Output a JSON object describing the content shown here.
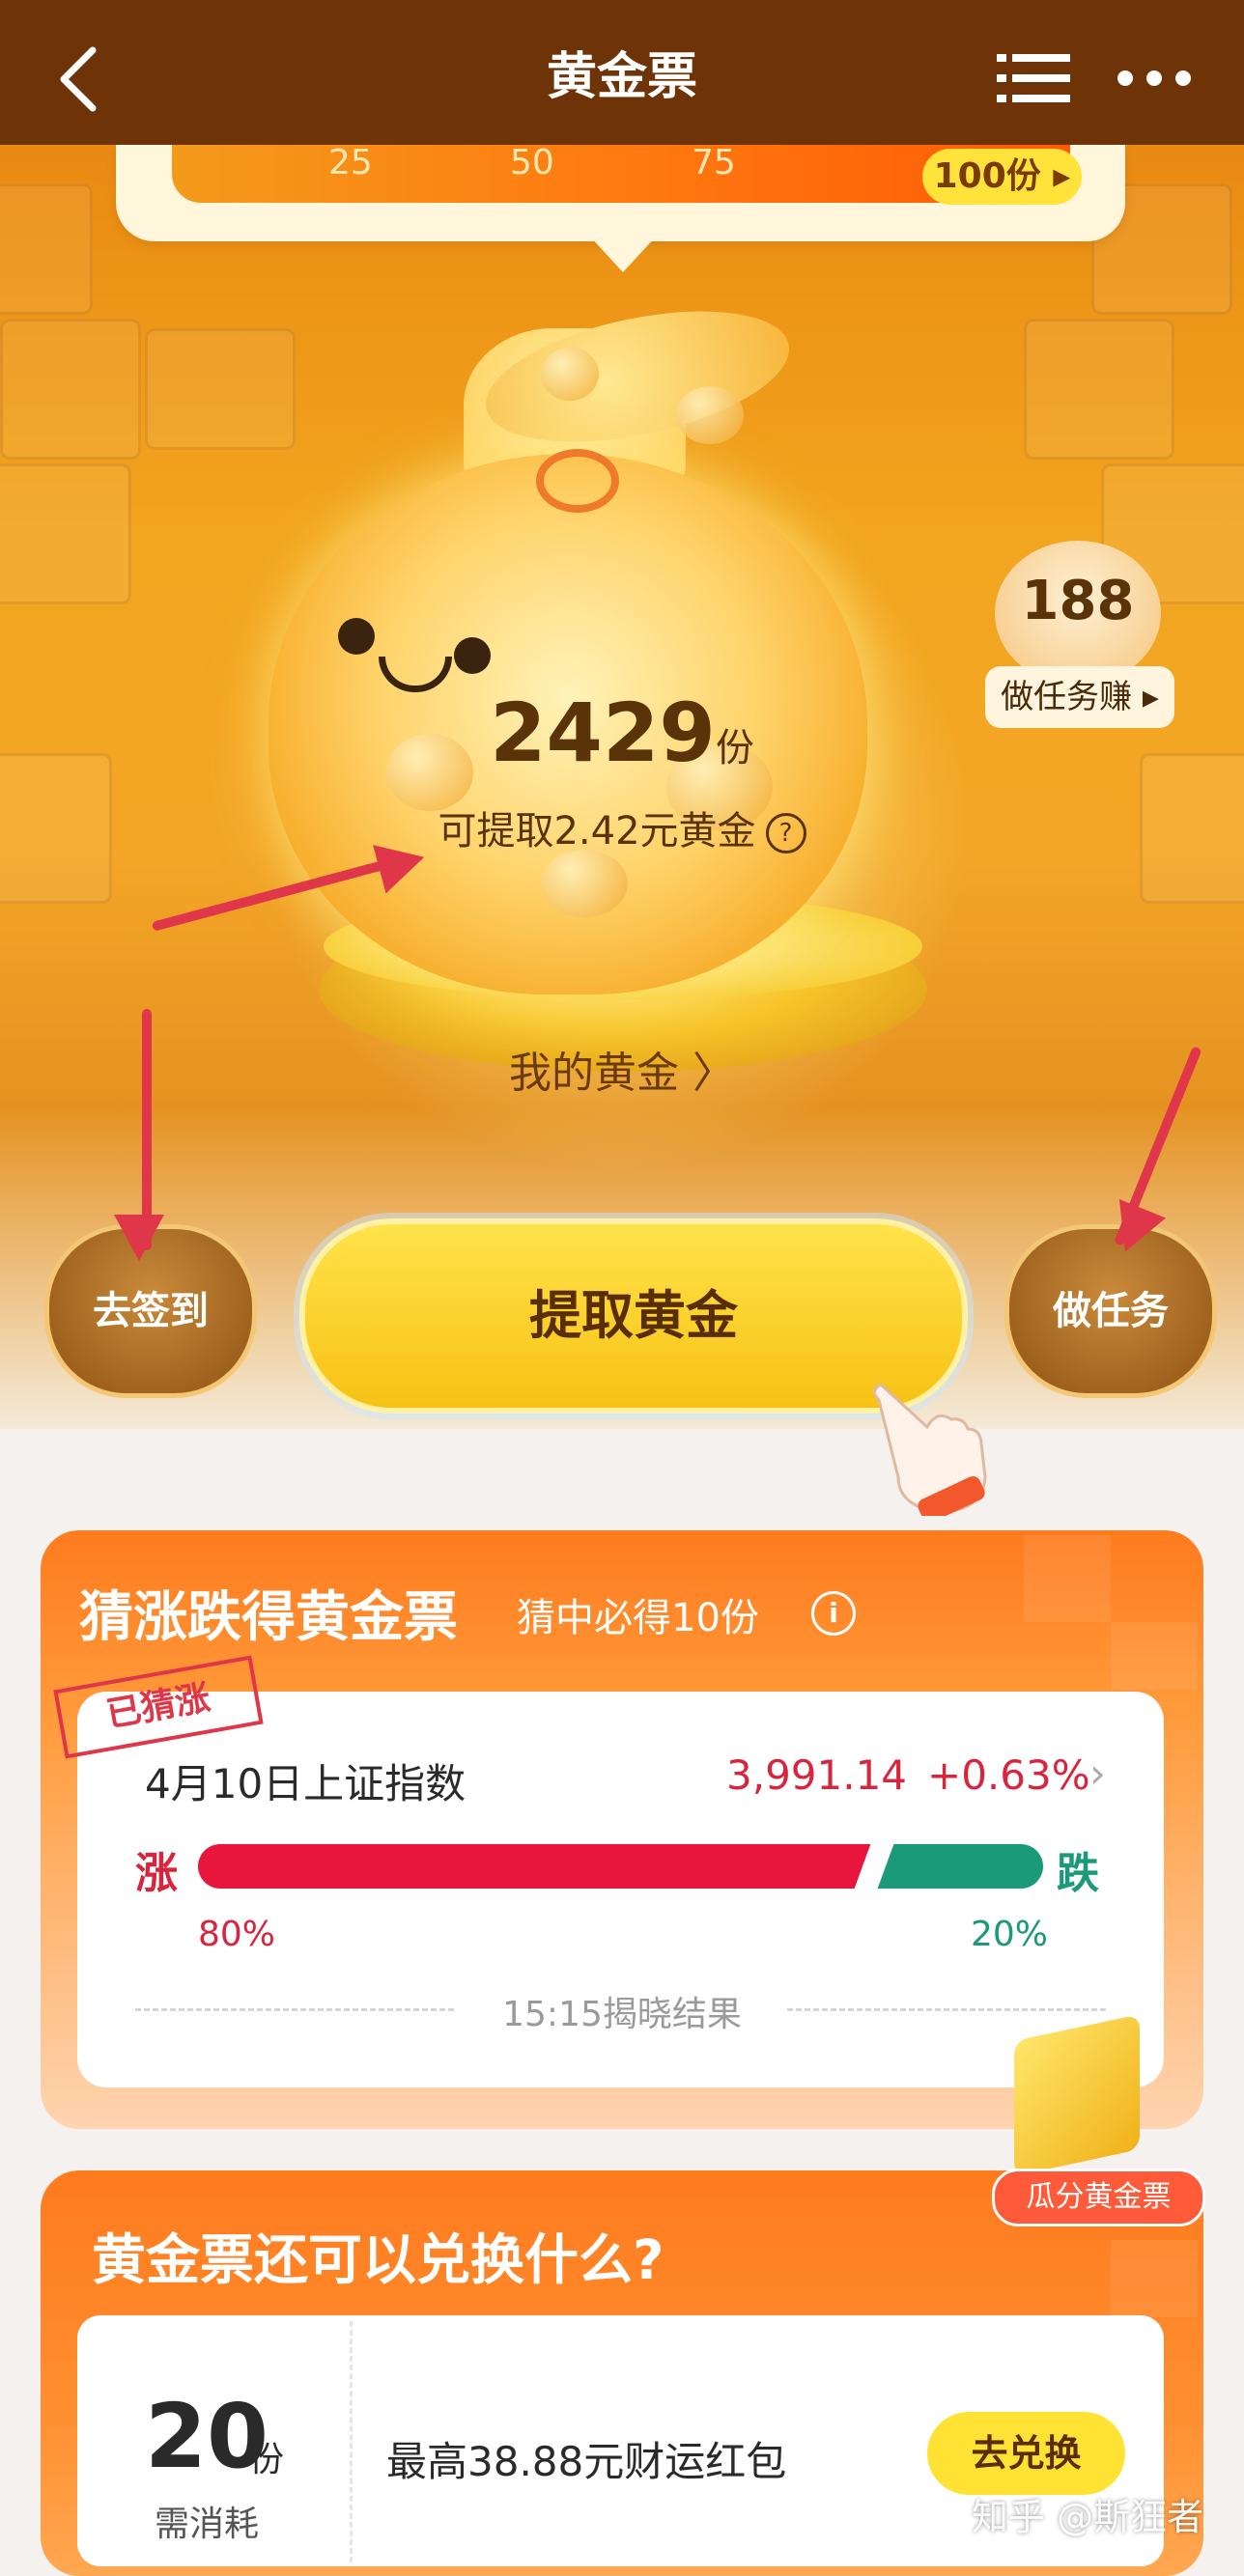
{
  "header": {
    "title": "黄金票"
  },
  "progress": {
    "ticks": [
      "25",
      "50",
      "75"
    ],
    "badge": "100份 ▸"
  },
  "balance": {
    "amount": "2429",
    "unit": "份",
    "withdrawable": "可提取2.42元黄金"
  },
  "my_gold_link": "我的黄金 〉",
  "task_chip": {
    "count": "188",
    "label": "做任务赚 ▸"
  },
  "actions": {
    "checkin": "去签到",
    "withdraw": "提取黄金",
    "tasks": "做任务"
  },
  "guess": {
    "title": "猜涨跌得黄金票",
    "subtitle": "猜中必得10份",
    "stamp": "已猜涨",
    "index_name": "4月10日上证指数",
    "index_value": "3,991.14",
    "index_change": "+0.63%",
    "rise_label": "涨",
    "fall_label": "跌",
    "rise_pct": "80%",
    "fall_pct": "20%",
    "rise_ratio": 0.8,
    "reveal": "15:15揭晓结果",
    "share_button": "瓜分黄金票"
  },
  "exchange": {
    "title": "黄金票还可以兑换什么?",
    "cost": "20",
    "cost_unit": "份",
    "cost_label": "需消耗",
    "reward": "最高38.88元财运红包",
    "button": "去兑换"
  },
  "watermark": "知乎 @斯狂者",
  "colors": {
    "header_bg": "#6e3306",
    "rise": "#e8163c",
    "fall": "#1b9a7a",
    "accent": "#ff7b1e",
    "button_yellow": "#ffe234"
  },
  "icons": [
    "back-icon",
    "list-icon",
    "more-icon",
    "question-icon",
    "info-icon",
    "hand-pointer-icon",
    "gold-bag-icon",
    "gold-bar-icon"
  ]
}
